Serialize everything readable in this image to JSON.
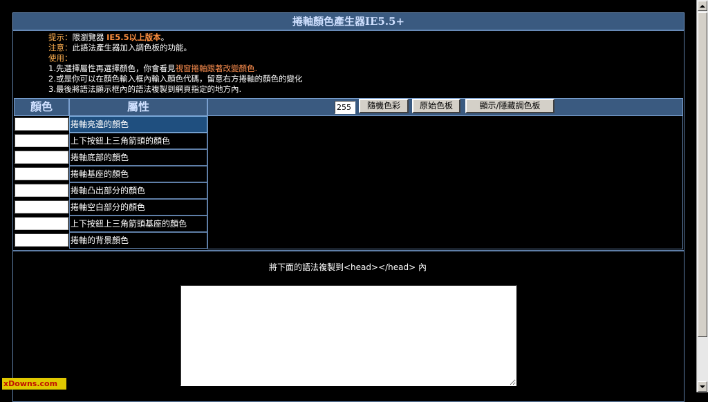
{
  "page": {
    "title": "捲軸顏色產生器IE5.5+"
  },
  "notes": {
    "tip_label": "提示：",
    "tip_text": "限瀏覽器 ",
    "tip_hl": "IE5.5以上版本",
    "tip_end": "。",
    "note_label": "注意：",
    "note_text": "此語法產生器加入調色板的功能。",
    "use_label": "使用：",
    "step1_a": "1.先選擇屬性再選擇顏色，你會看見",
    "step1_b": "視窗捲軸跟著改變顏色.",
    "step2": "2.或是你可以在顏色輸入框內輸入顏色代碼，留意右方捲軸的顏色的變化",
    "step3": "3.最後將語法顯示框內的語法複製到網頁指定的地方內."
  },
  "headers": {
    "color": "顏色",
    "property": "屬性"
  },
  "toolbar": {
    "number_value": "255",
    "random_label": "隨機色彩",
    "original_label": "原始色板",
    "toggle_label": "顯示/隱藏調色板"
  },
  "properties": [
    {
      "label": "捲軸亮邊的顏色",
      "selected": true
    },
    {
      "label": "上下按鈕上三角箭頭的顏色",
      "selected": false
    },
    {
      "label": "捲軸底部的顏色",
      "selected": false
    },
    {
      "label": "捲軸基座的顏色",
      "selected": false
    },
    {
      "label": "捲軸凸出部分的顏色",
      "selected": false
    },
    {
      "label": "捲軸空白部分的顏色",
      "selected": false
    },
    {
      "label": "上下按鈕上三角箭頭基座的顏色",
      "selected": false
    },
    {
      "label": "捲軸的背景顏色",
      "selected": false
    }
  ],
  "output": {
    "label": "將下面的語法複製到<head></head> 內"
  },
  "badge": {
    "text": "xDowns.com"
  },
  "colors": {
    "header_bg": "#3a5a80",
    "selected_bg": "#1f4f7f",
    "accent_orange": "#ff9040"
  }
}
